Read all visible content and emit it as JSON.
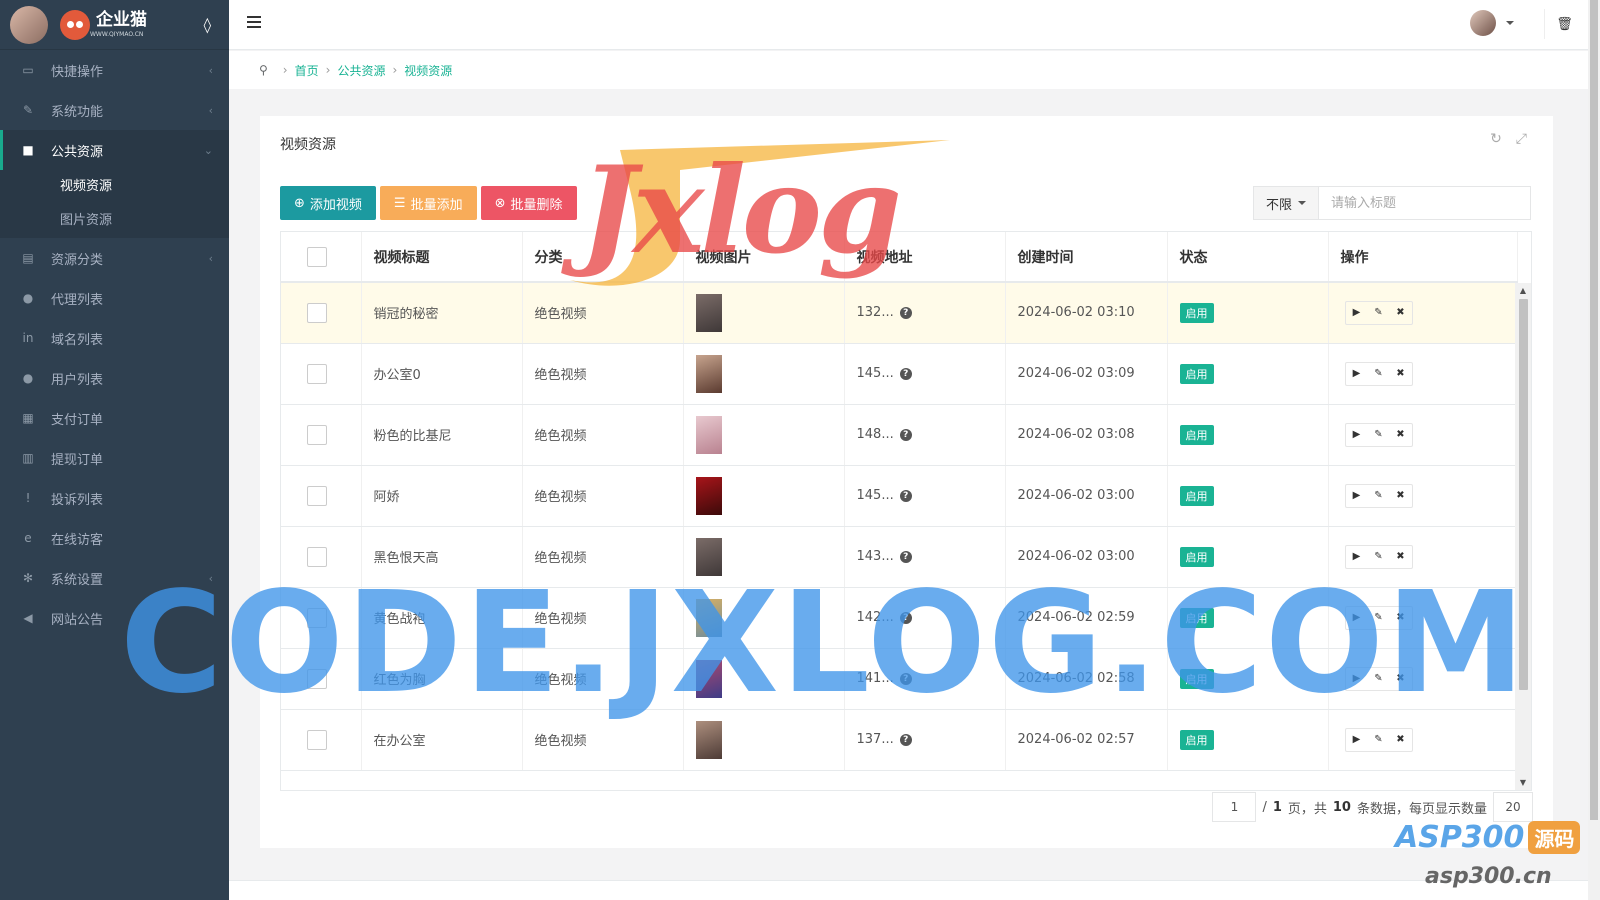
{
  "sidebar": {
    "brand_name": "企业猫",
    "brand_url": "WWW.QIYMAO.CN",
    "items": [
      {
        "label": "快捷操作",
        "icon": "folder-icon",
        "arrow": "‹"
      },
      {
        "label": "系统功能",
        "icon": "wrench-icon",
        "arrow": "‹"
      },
      {
        "label": "公共资源",
        "icon": "video-camera-icon",
        "arrow": "⌄"
      },
      {
        "label": "资源分类",
        "icon": "list-icon",
        "arrow": "‹"
      },
      {
        "label": "代理列表",
        "icon": "users-icon",
        "arrow": ""
      },
      {
        "label": "域名列表",
        "icon": "linkedin-icon",
        "arrow": ""
      },
      {
        "label": "用户列表",
        "icon": "user-icon",
        "arrow": ""
      },
      {
        "label": "支付订单",
        "icon": "database-icon",
        "arrow": ""
      },
      {
        "label": "提现订单",
        "icon": "bank-icon",
        "arrow": ""
      },
      {
        "label": "投诉列表",
        "icon": "exclamation-icon",
        "arrow": ""
      },
      {
        "label": "在线访客",
        "icon": "globe-icon",
        "arrow": ""
      },
      {
        "label": "系统设置",
        "icon": "gear-icon",
        "arrow": "‹"
      },
      {
        "label": "网站公告",
        "icon": "bullhorn-icon",
        "arrow": ""
      }
    ],
    "submenu": [
      {
        "label": "视频资源"
      },
      {
        "label": "图片资源"
      }
    ]
  },
  "breadcrumb": {
    "items": [
      "首页",
      "公共资源",
      "视频资源"
    ]
  },
  "panel": {
    "title": "视频资源",
    "buttons": {
      "add_video": "添加视频",
      "batch_add": "批量添加",
      "batch_delete": "批量删除"
    },
    "filter": {
      "select_value": "不限",
      "placeholder": "请输入标题"
    }
  },
  "table": {
    "columns": [
      "视频标题",
      "分类",
      "视频图片",
      "视频地址",
      "创建时间",
      "状态",
      "操作"
    ],
    "rows": [
      {
        "title": "销冠的秘密",
        "category": "绝色视频",
        "url": "132...",
        "created": "2024-06-02 03:10",
        "status": "启用"
      },
      {
        "title": "办公室0",
        "category": "绝色视频",
        "url": "145...",
        "created": "2024-06-02 03:09",
        "status": "启用"
      },
      {
        "title": "粉色的比基尼",
        "category": "绝色视频",
        "url": "148...",
        "created": "2024-06-02 03:08",
        "status": "启用"
      },
      {
        "title": "阿娇",
        "category": "绝色视频",
        "url": "145...",
        "created": "2024-06-02 03:00",
        "status": "启用"
      },
      {
        "title": "黑色恨天高",
        "category": "绝色视频",
        "url": "143...",
        "created": "2024-06-02 03:00",
        "status": "启用"
      },
      {
        "title": "黄色战袍",
        "category": "绝色视频",
        "url": "142...",
        "created": "2024-06-02 02:59",
        "status": "启用"
      },
      {
        "title": "红色为胸",
        "category": "绝色视频",
        "url": "141...",
        "created": "2024-06-02 02:58",
        "status": "启用"
      },
      {
        "title": "在办公室",
        "category": "绝色视频",
        "url": "137...",
        "created": "2024-06-02 02:57",
        "status": "启用"
      }
    ]
  },
  "pagination": {
    "current": "1",
    "text_prefix": "/",
    "total_pages": "1",
    "text_mid": "页，共",
    "total_records": "10",
    "text_suffix": "条数据，每页显示数量",
    "page_size": "20"
  },
  "watermarks": {
    "cursive": "Jxlog",
    "big": "CODE.JXLOG.COM",
    "asp": "ASP300",
    "asp_tag": "源码",
    "asp_url": "asp300.cn"
  },
  "colors": {
    "sidebar_bg": "#2f4050",
    "accent": "#1ab394",
    "orange": "#f8ac59",
    "red": "#ed5565"
  }
}
